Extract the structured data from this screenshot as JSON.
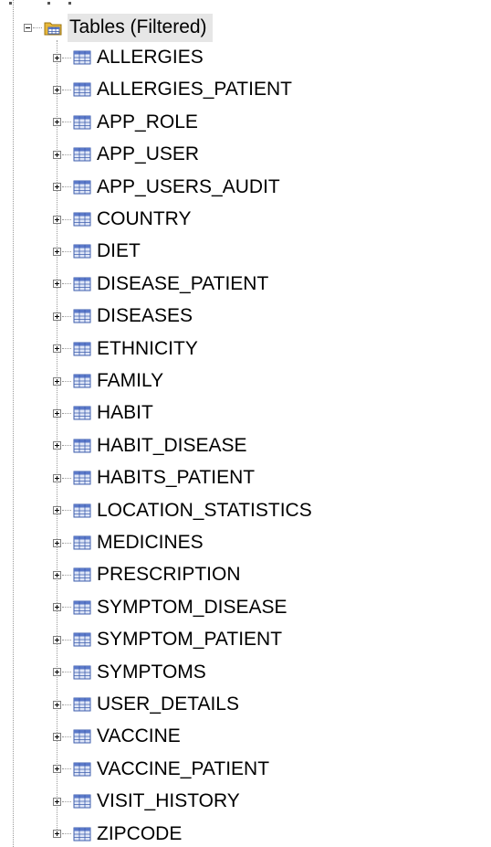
{
  "tree": {
    "root": {
      "label": "Tables (Filtered)",
      "expanded": true,
      "icon": "folder-table-icon"
    },
    "item_icon": "table-icon",
    "items": [
      {
        "label": "ALLERGIES"
      },
      {
        "label": "ALLERGIES_PATIENT"
      },
      {
        "label": "APP_ROLE"
      },
      {
        "label": "APP_USER"
      },
      {
        "label": "APP_USERS_AUDIT"
      },
      {
        "label": "COUNTRY"
      },
      {
        "label": "DIET"
      },
      {
        "label": "DISEASE_PATIENT"
      },
      {
        "label": "DISEASES"
      },
      {
        "label": "ETHNICITY"
      },
      {
        "label": "FAMILY"
      },
      {
        "label": "HABIT"
      },
      {
        "label": "HABIT_DISEASE"
      },
      {
        "label": "HABITS_PATIENT"
      },
      {
        "label": "LOCATION_STATISTICS"
      },
      {
        "label": "MEDICINES"
      },
      {
        "label": "PRESCRIPTION"
      },
      {
        "label": "SYMPTOM_DISEASE"
      },
      {
        "label": "SYMPTOM_PATIENT"
      },
      {
        "label": "SYMPTOMS"
      },
      {
        "label": "USER_DETAILS"
      },
      {
        "label": "VACCINE"
      },
      {
        "label": "VACCINE_PATIENT"
      },
      {
        "label": "VISIT_HISTORY"
      },
      {
        "label": "ZIPCODE"
      }
    ]
  },
  "colors": {
    "selection_bg": "#e6e6e6",
    "guide_line": "#9a9a9a",
    "folder_yellow": "#e8b83a",
    "table_blue": "#5b79c9",
    "table_cell": "#dfe6f7"
  }
}
